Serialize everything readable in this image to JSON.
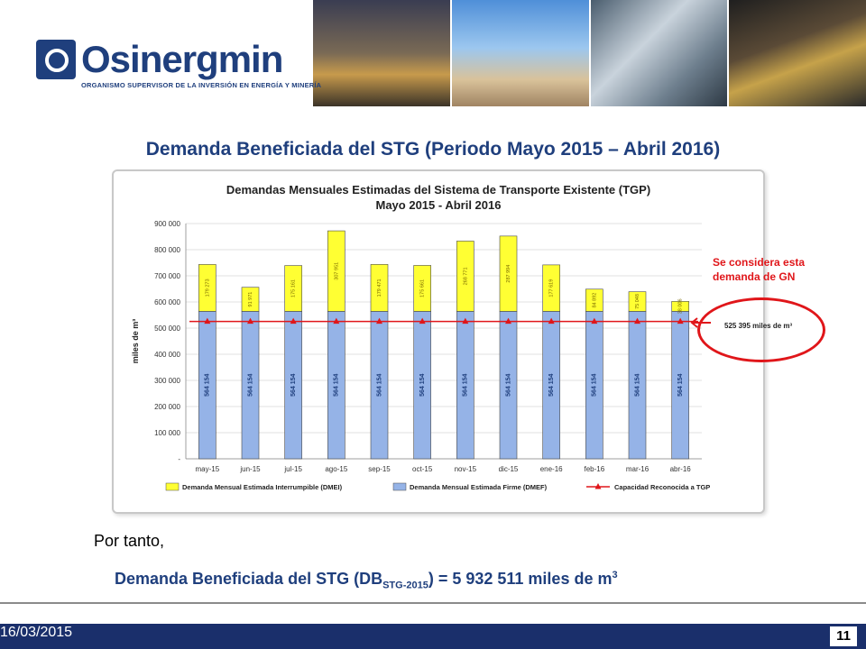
{
  "header": {
    "logo_text": "Osinergmin",
    "logo_subtitle": "ORGANISMO SUPERVISOR DE LA INVERSIÓN EN ENERGÍA Y MINERÍA"
  },
  "slide": {
    "title": "Demanda Beneficiada del STG (Periodo Mayo 2015 – Abril 2016)",
    "callout_text": "Se considera esta demanda de GN",
    "callout_value": "525 395 miles de m³",
    "conclusion_prefix": "Por tanto,",
    "result_prefix": "Demanda Beneficiada del STG (DB",
    "result_sub": "STG-2015",
    "result_suffix": ") = 5 932 511 miles de m",
    "result_sup": "3",
    "footer_date": "16/03/2015",
    "page_number": "11"
  },
  "colors": {
    "brand": "#1f3f7d",
    "firm": "#95b3e7",
    "interruptible": "#ffff33",
    "capacity": "#e0161a"
  },
  "chart_data": {
    "type": "bar",
    "stacked": true,
    "title_line1": "Demandas Mensuales Estimadas del Sistema de Transporte Existente (TGP)",
    "title_line2": "Mayo 2015 - Abril 2016",
    "ylabel": "miles de m³",
    "xlabel": "",
    "ylim": [
      0,
      900000
    ],
    "yticks": [
      0,
      100000,
      200000,
      300000,
      400000,
      500000,
      600000,
      700000,
      800000,
      900000
    ],
    "ytick_labels": [
      "-",
      "100 000",
      "200 000",
      "300 000",
      "400 000",
      "500 000",
      "600 000",
      "700 000",
      "800 000",
      "900 000"
    ],
    "grid": true,
    "legend_position": "bottom",
    "categories": [
      "may-15",
      "jun-15",
      "jul-15",
      "ago-15",
      "sep-15",
      "oct-15",
      "nov-15",
      "dic-15",
      "ene-16",
      "feb-16",
      "mar-16",
      "abr-16"
    ],
    "series": [
      {
        "name": "Demanda Mensual Estimada Firme (DMEF)",
        "values": [
          564154,
          564154,
          564154,
          564154,
          564154,
          564154,
          564154,
          564154,
          564154,
          564154,
          564154,
          564154
        ],
        "labels": [
          "564 154",
          "564 154",
          "564 154",
          "564 154",
          "564 154",
          "564 154",
          "564 154",
          "564 154",
          "564 154",
          "564 154",
          "564 154",
          "564 154"
        ]
      },
      {
        "name": "Demanda Mensual Estimada Interrumpible (DMEI)",
        "values": [
          179273,
          91971,
          175161,
          307951,
          179471,
          175661,
          268771,
          287994,
          177619,
          84892,
          75048,
          38006
        ],
        "labels": [
          "179 273",
          "91 971",
          "175 161",
          "307 951",
          "179 471",
          "175 661",
          "268 771",
          "287 994",
          "177 619",
          "84 892",
          "75 048",
          "38 006"
        ]
      },
      {
        "name": "Capacidad Reconocida a TGP",
        "type": "line",
        "values": [
          525395,
          525395,
          525395,
          525395,
          525395,
          525395,
          525395,
          525395,
          525395,
          525395,
          525395,
          525395
        ]
      }
    ]
  }
}
